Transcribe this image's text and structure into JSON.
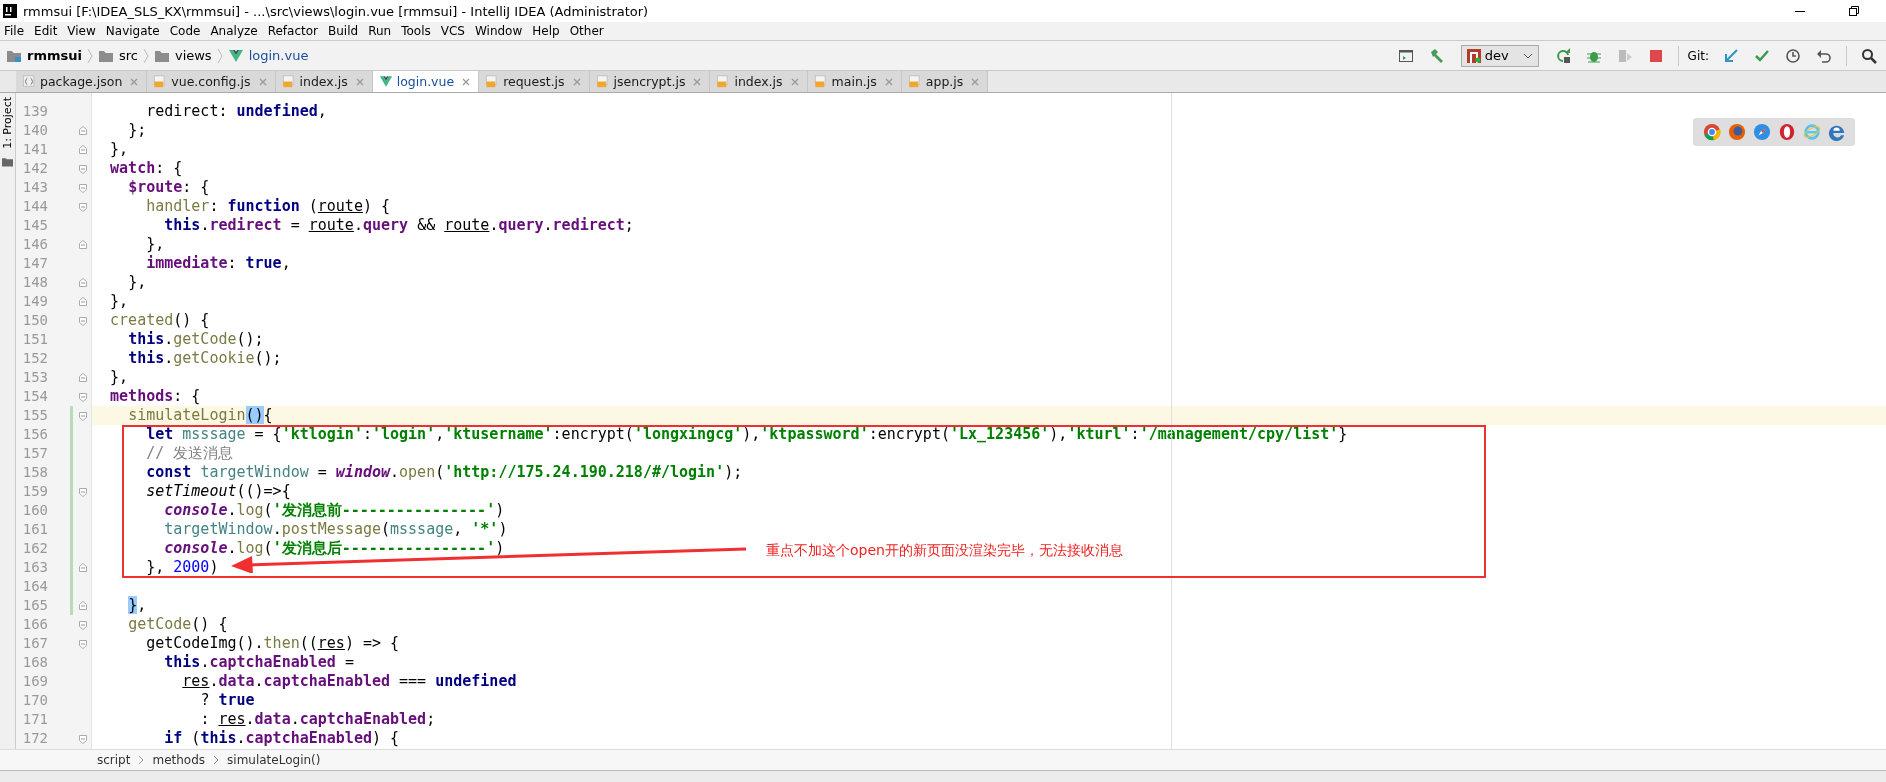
{
  "window": {
    "title": "rmmsui [F:\\IDEA_SLS_KX\\rmmsui] - ...\\src\\views\\login.vue [rmmsui] - IntelliJ IDEA (Administrator)"
  },
  "menu": [
    "File",
    "Edit",
    "View",
    "Navigate",
    "Code",
    "Analyze",
    "Refactor",
    "Build",
    "Run",
    "Tools",
    "VCS",
    "Window",
    "Help",
    "Other"
  ],
  "navigation": [
    {
      "label": "rmmsui",
      "kind": "project"
    },
    {
      "label": "src",
      "kind": "folder"
    },
    {
      "label": "views",
      "kind": "folder"
    },
    {
      "label": "login.vue",
      "kind": "vue"
    }
  ],
  "run_config": "dev",
  "git_label": "Git:",
  "side_tab": "1: Project",
  "tabs": [
    {
      "label": "package.json",
      "kind": "json",
      "selected": false
    },
    {
      "label": "vue.config.js",
      "kind": "js",
      "selected": false
    },
    {
      "label": "index.js",
      "kind": "js",
      "selected": false
    },
    {
      "label": "login.vue",
      "kind": "vue",
      "selected": true
    },
    {
      "label": "request.js",
      "kind": "js",
      "selected": false
    },
    {
      "label": "jsencrypt.js",
      "kind": "js",
      "selected": false
    },
    {
      "label": "index.js",
      "kind": "js",
      "selected": false
    },
    {
      "label": "main.js",
      "kind": "js",
      "selected": false
    },
    {
      "label": "app.js",
      "kind": "js",
      "selected": false
    }
  ],
  "lines": [
    {
      "number": "139",
      "kind": "plain",
      "changed": false,
      "current": false,
      "tokens": [
        {
          "kind": "plain",
          "text": "      redirect: "
        },
        {
          "kind": "kw",
          "text": "undefined"
        },
        {
          "kind": "plain",
          "text": ","
        }
      ]
    },
    {
      "number": "140",
      "kind": "closer",
      "changed": false,
      "current": false,
      "tokens": [
        {
          "kind": "plain",
          "text": "    };"
        }
      ]
    },
    {
      "number": "141",
      "kind": "closer",
      "changed": false,
      "current": false,
      "tokens": [
        {
          "kind": "plain",
          "text": "  },"
        }
      ]
    },
    {
      "number": "142",
      "kind": "opener",
      "changed": false,
      "current": false,
      "tokens": [
        {
          "kind": "prop",
          "text": "  watch"
        },
        {
          "kind": "plain",
          "text": ": {"
        }
      ]
    },
    {
      "number": "143",
      "kind": "opener",
      "changed": false,
      "current": false,
      "tokens": [
        {
          "kind": "prop",
          "text": "    $route"
        },
        {
          "kind": "plain",
          "text": ": {"
        }
      ]
    },
    {
      "number": "144",
      "kind": "opener",
      "changed": false,
      "current": false,
      "tokens": [
        {
          "kind": "method",
          "text": "      handler"
        },
        {
          "kind": "plain",
          "text": ": "
        },
        {
          "kind": "kw",
          "text": "function"
        },
        {
          "kind": "plain",
          "text": " ("
        },
        {
          "kind": "param",
          "text": "route"
        },
        {
          "kind": "plain",
          "text": ") {"
        }
      ]
    },
    {
      "number": "145",
      "kind": "plain",
      "changed": false,
      "current": false,
      "tokens": [
        {
          "kind": "kw",
          "text": "        this"
        },
        {
          "kind": "plain",
          "text": "."
        },
        {
          "kind": "prop",
          "text": "redirect"
        },
        {
          "kind": "plain",
          "text": " = "
        },
        {
          "kind": "param",
          "text": "route"
        },
        {
          "kind": "plain",
          "text": "."
        },
        {
          "kind": "prop",
          "text": "query"
        },
        {
          "kind": "plain",
          "text": " && "
        },
        {
          "kind": "param",
          "text": "route"
        },
        {
          "kind": "plain",
          "text": "."
        },
        {
          "kind": "prop",
          "text": "query"
        },
        {
          "kind": "plain",
          "text": "."
        },
        {
          "kind": "prop",
          "text": "redirect"
        },
        {
          "kind": "plain",
          "text": ";"
        }
      ]
    },
    {
      "number": "146",
      "kind": "closer",
      "changed": false,
      "current": false,
      "tokens": [
        {
          "kind": "plain",
          "text": "      },"
        }
      ]
    },
    {
      "number": "147",
      "kind": "plain",
      "changed": false,
      "current": false,
      "tokens": [
        {
          "kind": "prop",
          "text": "      immediate"
        },
        {
          "kind": "plain",
          "text": ": "
        },
        {
          "kind": "kw",
          "text": "true"
        },
        {
          "kind": "plain",
          "text": ","
        }
      ]
    },
    {
      "number": "148",
      "kind": "closer",
      "changed": false,
      "current": false,
      "tokens": [
        {
          "kind": "plain",
          "text": "    },"
        }
      ]
    },
    {
      "number": "149",
      "kind": "closer",
      "changed": false,
      "current": false,
      "tokens": [
        {
          "kind": "plain",
          "text": "  },"
        }
      ]
    },
    {
      "number": "150",
      "kind": "opener",
      "changed": false,
      "current": false,
      "tokens": [
        {
          "kind": "method",
          "text": "  created"
        },
        {
          "kind": "plain",
          "text": "() {"
        }
      ]
    },
    {
      "number": "151",
      "kind": "plain",
      "changed": false,
      "current": false,
      "tokens": [
        {
          "kind": "kw",
          "text": "    this"
        },
        {
          "kind": "plain",
          "text": "."
        },
        {
          "kind": "method",
          "text": "getCode"
        },
        {
          "kind": "plain",
          "text": "();"
        }
      ]
    },
    {
      "number": "152",
      "kind": "plain",
      "changed": false,
      "current": false,
      "tokens": [
        {
          "kind": "kw",
          "text": "    this"
        },
        {
          "kind": "plain",
          "text": "."
        },
        {
          "kind": "method",
          "text": "getCookie"
        },
        {
          "kind": "plain",
          "text": "();"
        }
      ]
    },
    {
      "number": "153",
      "kind": "closer",
      "changed": false,
      "current": false,
      "tokens": [
        {
          "kind": "plain",
          "text": "  },"
        }
      ]
    },
    {
      "number": "154",
      "kind": "opener",
      "changed": false,
      "current": false,
      "tokens": [
        {
          "kind": "prop",
          "text": "  methods"
        },
        {
          "kind": "plain",
          "text": ": {"
        }
      ]
    },
    {
      "number": "155",
      "kind": "opener",
      "changed": true,
      "current": true,
      "tokens": [
        {
          "kind": "method",
          "text": "    simulateLogin"
        },
        {
          "kind": "match",
          "text": "()"
        },
        {
          "kind": "plain",
          "text": "{"
        }
      ]
    },
    {
      "number": "156",
      "kind": "plain",
      "changed": true,
      "current": false,
      "tokens": [
        {
          "kind": "kw",
          "text": "      let "
        },
        {
          "kind": "var",
          "text": "msssage"
        },
        {
          "kind": "plain",
          "text": " = {"
        },
        {
          "kind": "str",
          "text": "'ktlogin'"
        },
        {
          "kind": "plain",
          "text": ":"
        },
        {
          "kind": "str",
          "text": "'login'"
        },
        {
          "kind": "plain",
          "text": ","
        },
        {
          "kind": "str",
          "text": "'ktusername'"
        },
        {
          "kind": "plain",
          "text": ":encrypt("
        },
        {
          "kind": "str",
          "text": "'longxingcg'"
        },
        {
          "kind": "plain",
          "text": "),"
        },
        {
          "kind": "str",
          "text": "'ktpassword'"
        },
        {
          "kind": "plain",
          "text": ":encrypt("
        },
        {
          "kind": "str",
          "text": "'Lx_123456'"
        },
        {
          "kind": "plain",
          "text": "),"
        },
        {
          "kind": "str",
          "text": "'kturl'"
        },
        {
          "kind": "plain",
          "text": ":"
        },
        {
          "kind": "str",
          "text": "'/management/cpy/list'"
        },
        {
          "kind": "plain",
          "text": "}"
        }
      ]
    },
    {
      "number": "157",
      "kind": "plain",
      "changed": true,
      "current": false,
      "tokens": [
        {
          "kind": "comment",
          "text": "      // 发送消息"
        }
      ]
    },
    {
      "number": "158",
      "kind": "plain",
      "changed": true,
      "current": false,
      "tokens": [
        {
          "kind": "kw",
          "text": "      const "
        },
        {
          "kind": "var",
          "text": "targetWindow"
        },
        {
          "kind": "plain",
          "text": " = "
        },
        {
          "kind": "global",
          "text": "window"
        },
        {
          "kind": "plain",
          "text": "."
        },
        {
          "kind": "method",
          "text": "open"
        },
        {
          "kind": "plain",
          "text": "("
        },
        {
          "kind": "str",
          "text": "'http://175.24.190.218/#/login'"
        },
        {
          "kind": "plain",
          "text": ");"
        }
      ]
    },
    {
      "number": "159",
      "kind": "opener",
      "changed": true,
      "current": false,
      "tokens": [
        {
          "kind": "italic",
          "text": "      setTimeout"
        },
        {
          "kind": "plain",
          "text": "(()=>{"
        }
      ]
    },
    {
      "number": "160",
      "kind": "plain",
      "changed": true,
      "current": false,
      "tokens": [
        {
          "kind": "global",
          "text": "        console"
        },
        {
          "kind": "plain",
          "text": "."
        },
        {
          "kind": "method",
          "text": "log"
        },
        {
          "kind": "plain",
          "text": "("
        },
        {
          "kind": "str",
          "text": "'发消息前----------------'"
        },
        {
          "kind": "plain",
          "text": ")"
        }
      ]
    },
    {
      "number": "161",
      "kind": "plain",
      "changed": true,
      "current": false,
      "tokens": [
        {
          "kind": "var",
          "text": "        targetWindow"
        },
        {
          "kind": "plain",
          "text": "."
        },
        {
          "kind": "method",
          "text": "postMessage"
        },
        {
          "kind": "plain",
          "text": "("
        },
        {
          "kind": "var",
          "text": "msssage"
        },
        {
          "kind": "plain",
          "text": ", "
        },
        {
          "kind": "str",
          "text": "'*'"
        },
        {
          "kind": "plain",
          "text": ")"
        }
      ]
    },
    {
      "number": "162",
      "kind": "plain",
      "changed": true,
      "current": false,
      "tokens": [
        {
          "kind": "global",
          "text": "        console"
        },
        {
          "kind": "plain",
          "text": "."
        },
        {
          "kind": "method",
          "text": "log"
        },
        {
          "kind": "plain",
          "text": "("
        },
        {
          "kind": "str",
          "text": "'发消息后----------------'"
        },
        {
          "kind": "plain",
          "text": ")"
        }
      ]
    },
    {
      "number": "163",
      "kind": "closer",
      "changed": true,
      "current": false,
      "tokens": [
        {
          "kind": "plain",
          "text": "      }, "
        },
        {
          "kind": "num",
          "text": "2000"
        },
        {
          "kind": "plain",
          "text": ")"
        }
      ]
    },
    {
      "number": "164",
      "kind": "plain",
      "changed": true,
      "current": false
    },
    {
      "number": "165",
      "kind": "closer",
      "changed": true,
      "current": false,
      "tokens": [
        {
          "kind": "match",
          "text": "    }"
        },
        {
          "kind": "plain",
          "text": ","
        }
      ]
    },
    {
      "number": "166",
      "kind": "opener",
      "changed": false,
      "current": false,
      "tokens": [
        {
          "kind": "method",
          "text": "    getCode"
        },
        {
          "kind": "plain",
          "text": "() {"
        }
      ]
    },
    {
      "number": "167",
      "kind": "opener",
      "changed": false,
      "current": false,
      "tokens": [
        {
          "kind": "plain",
          "text": "      getCodeImg()."
        },
        {
          "kind": "method",
          "text": "then"
        },
        {
          "kind": "plain",
          "text": "(("
        },
        {
          "kind": "param",
          "text": "res"
        },
        {
          "kind": "plain",
          "text": ") => {"
        }
      ]
    },
    {
      "number": "168",
      "kind": "plain",
      "changed": false,
      "current": false,
      "tokens": [
        {
          "kind": "kw",
          "text": "        this"
        },
        {
          "kind": "plain",
          "text": "."
        },
        {
          "kind": "prop",
          "text": "captchaEnabled"
        },
        {
          "kind": "plain",
          "text": " ="
        }
      ]
    },
    {
      "number": "169",
      "kind": "plain",
      "changed": false,
      "current": false,
      "tokens": [
        {
          "kind": "param",
          "text": "          res"
        },
        {
          "kind": "plain",
          "text": "."
        },
        {
          "kind": "prop",
          "text": "data"
        },
        {
          "kind": "plain",
          "text": "."
        },
        {
          "kind": "prop",
          "text": "captchaEnabled"
        },
        {
          "kind": "plain",
          "text": " === "
        },
        {
          "kind": "kw",
          "text": "undefined"
        }
      ]
    },
    {
      "number": "170",
      "kind": "plain",
      "changed": false,
      "current": false,
      "tokens": [
        {
          "kind": "plain",
          "text": "            ? "
        },
        {
          "kind": "kw",
          "text": "true"
        }
      ]
    },
    {
      "number": "171",
      "kind": "plain",
      "changed": false,
      "current": false,
      "tokens": [
        {
          "kind": "plain",
          "text": "            : "
        },
        {
          "kind": "param",
          "text": "res"
        },
        {
          "kind": "plain",
          "text": "."
        },
        {
          "kind": "prop",
          "text": "data"
        },
        {
          "kind": "plain",
          "text": "."
        },
        {
          "kind": "prop",
          "text": "captchaEnabled"
        },
        {
          "kind": "plain",
          "text": ";"
        }
      ]
    },
    {
      "number": "172",
      "kind": "opener",
      "changed": false,
      "current": false,
      "tokens": [
        {
          "kind": "kw",
          "text": "        if "
        },
        {
          "kind": "plain",
          "text": "("
        },
        {
          "kind": "kw",
          "text": "this"
        },
        {
          "kind": "plain",
          "text": "."
        },
        {
          "kind": "prop",
          "text": "captchaEnabled"
        },
        {
          "kind": "plain",
          "text": ") {"
        }
      ]
    }
  ],
  "annotation": {
    "text": "重点不加这个open开的新页面没渲染完毕，无法接收消息"
  },
  "breadcrumb": [
    "script",
    "methods",
    "simulateLogin()"
  ]
}
